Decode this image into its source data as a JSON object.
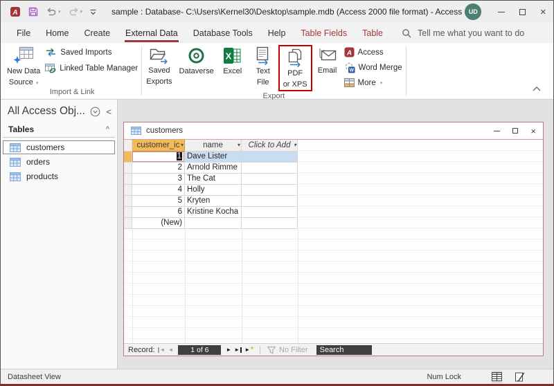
{
  "titlebar": {
    "title": "sample : Database- C:\\Users\\Kernel30\\Desktop\\sample.mdb (Access 2000 file format) -  Access",
    "avatar_initials": "UD"
  },
  "tabs": [
    {
      "label": "File"
    },
    {
      "label": "Home"
    },
    {
      "label": "Create"
    },
    {
      "label": "External Data"
    },
    {
      "label": "Database Tools"
    },
    {
      "label": "Help"
    },
    {
      "label": "Table Fields"
    },
    {
      "label": "Table"
    }
  ],
  "tellme": {
    "text": "Tell me what you want to do"
  },
  "ribbon": {
    "import_link": {
      "group_label": "Import & Link",
      "new_data_source_l1": "New Data",
      "new_data_source_l2": "Source",
      "saved_imports": "Saved Imports",
      "linked_table_manager": "Linked Table Manager"
    },
    "export": {
      "group_label": "Export",
      "saved_exports_l1": "Saved",
      "saved_exports_l2": "Exports",
      "dataverse": "Dataverse",
      "excel": "Excel",
      "text_file_l1": "Text",
      "text_file_l2": "File",
      "pdf_xps_l1": "PDF",
      "pdf_xps_l2": "or XPS",
      "email": "Email",
      "access": "Access",
      "word_merge": "Word Merge",
      "more": "More"
    }
  },
  "sidebar": {
    "title": "All Access Obj...",
    "collapse_glyph": "<",
    "group_label": "Tables",
    "group_chevron": "^",
    "items": [
      {
        "label": "customers"
      },
      {
        "label": "orders"
      },
      {
        "label": "products"
      }
    ]
  },
  "window": {
    "title": "customers",
    "columns": [
      {
        "label": "customer_ic"
      },
      {
        "label": "name"
      },
      {
        "label": "Click to Add"
      }
    ],
    "rows": [
      {
        "id": "1",
        "name": "Dave Lister"
      },
      {
        "id": "2",
        "name": "Arnold Rimme"
      },
      {
        "id": "3",
        "name": "The Cat"
      },
      {
        "id": "4",
        "name": "Holly"
      },
      {
        "id": "5",
        "name": "Kryten"
      },
      {
        "id": "6",
        "name": "Kristine Kocha"
      }
    ],
    "new_row_label": "(New)",
    "record_bar": {
      "label": "Record:",
      "position": "1 of 6",
      "no_filter": "No Filter",
      "search": "Search"
    }
  },
  "statusbar": {
    "view": "Datasheet View",
    "num_lock": "Num Lock"
  },
  "glyphs": {
    "caret_down": "▾",
    "chevron_left": "<",
    "chevron_up": "^",
    "nav_prev": "◄",
    "nav_next": "►",
    "nav_star": "*",
    "close": "×",
    "maximize": "",
    "minimize": ""
  },
  "colors": {
    "accent_maroon": "#9c3a38",
    "contextual_tab": "#a4373a",
    "selected_header": "#f2ba58",
    "selection_blue": "#c9ddf1",
    "window_border": "#b97a7a",
    "highlight_box": "#c00000",
    "nav_box_bg": "#3f3f3f",
    "avatar_bg": "#4e7d72"
  }
}
